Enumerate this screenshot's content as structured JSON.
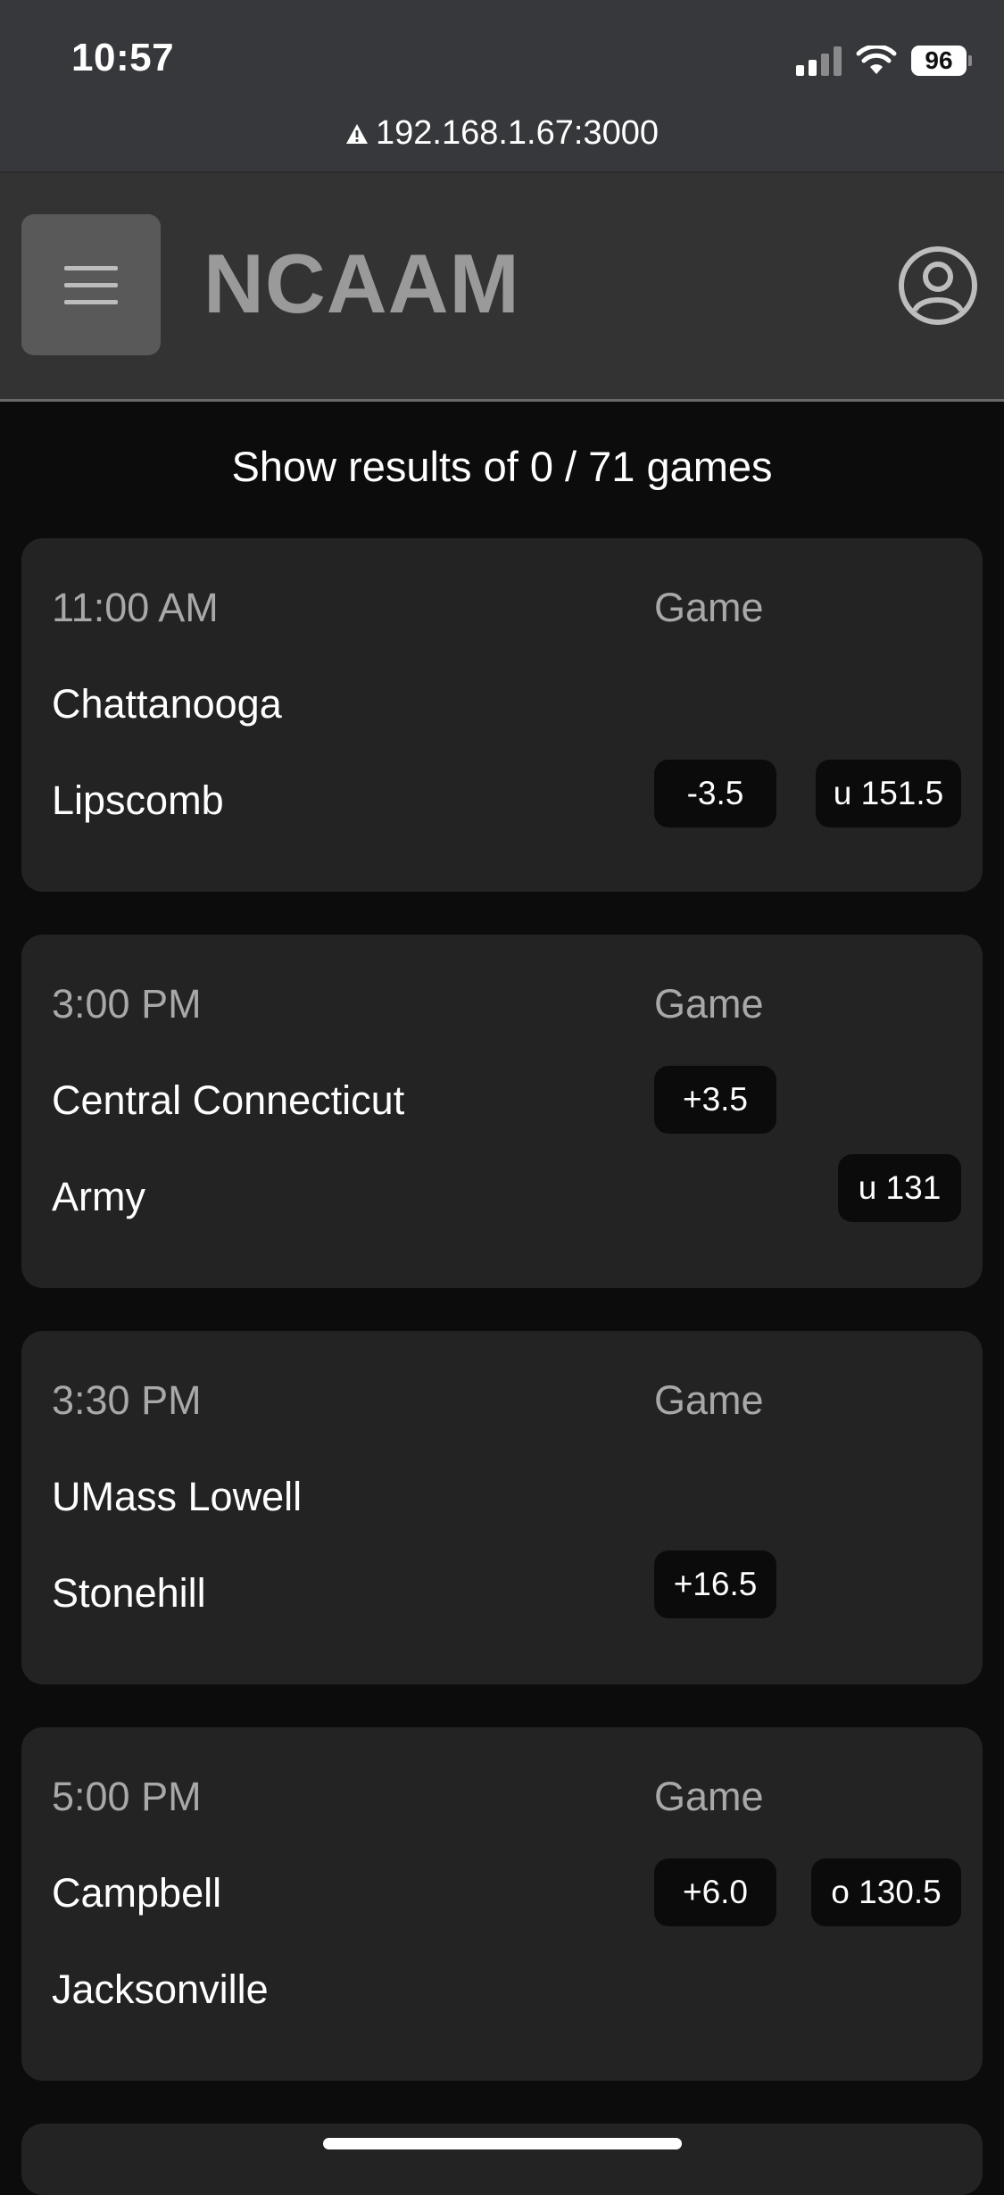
{
  "status_bar": {
    "time": "10:57",
    "battery": "96",
    "icons": [
      "signal-icon",
      "wifi-icon",
      "battery-icon"
    ]
  },
  "browser": {
    "url": "192.168.1.67:3000",
    "url_icon": "warning-icon"
  },
  "header": {
    "title": "NCAAM",
    "menu_icon": "hamburger-icon",
    "account_icon": "user-circle-icon"
  },
  "results": {
    "text": "Show results of 0 / 71 games"
  },
  "games": [
    {
      "time": "11:00 AM",
      "column_label": "Game",
      "team1": "Chattanooga",
      "team2": "Lipscomb",
      "spread": "-3.5",
      "total": "u 151.5"
    },
    {
      "time": "3:00 PM",
      "column_label": "Game",
      "team1": "Central Connecticut",
      "team2": "Army",
      "spread": "+3.5",
      "total": "u 131"
    },
    {
      "time": "3:30 PM",
      "column_label": "Game",
      "team1": "UMass Lowell",
      "team2": "Stonehill",
      "spread": "+16.5",
      "total": ""
    },
    {
      "time": "5:00 PM",
      "column_label": "Game",
      "team1": "Campbell",
      "team2": "Jacksonville",
      "spread": "+6.0",
      "total": "o 130.5"
    }
  ],
  "colors": {
    "page_bg": "#0c0c0c",
    "card_bg": "#232323",
    "header_bg": "#333333",
    "pill_bg": "#0b0b0b",
    "muted_text": "#a8a8a8",
    "title_text": "#9a9a9a"
  }
}
